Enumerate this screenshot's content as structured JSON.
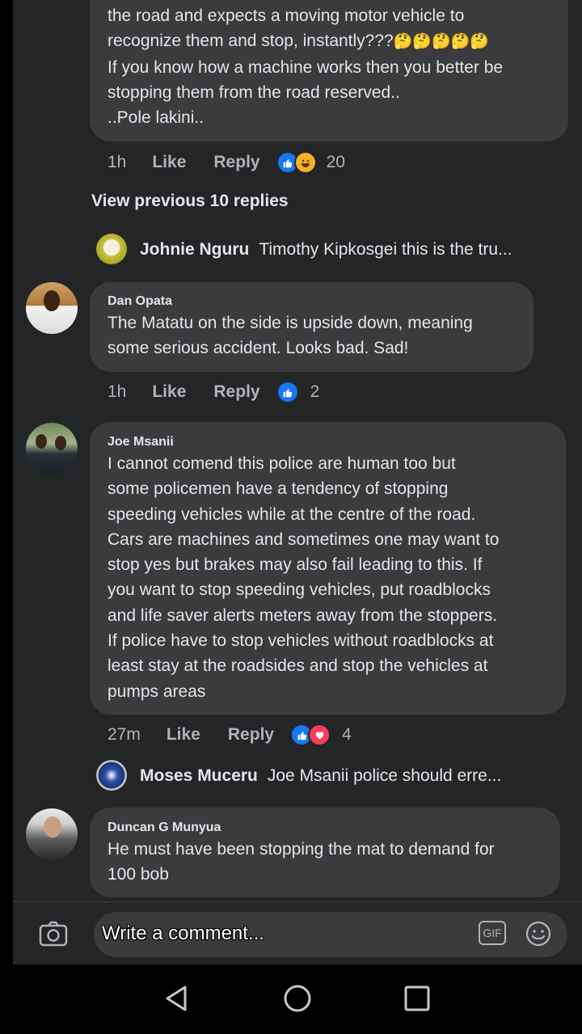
{
  "comments": [
    {
      "id": "top",
      "text": "the road and expects a moving motor vehicle to recognize them and stop, instantly???🤔🤔🤔🤔🤔 If you know how a machine works then you better be stopping them from the road reserved.. ..Pole lakini..",
      "lines": [
        "the road and expects a moving motor vehicle to",
        "recognize them and stop, instantly???",
        "If you know how a machine works then you better be",
        "stopping them from the road reserved..",
        "..Pole lakini.."
      ],
      "time": "1h",
      "like_label": "Like",
      "reply_label": "Reply",
      "reaction_count": "20"
    },
    {
      "id": "dan",
      "name": "Dan Opata",
      "lines": [
        "The Matatu on the side is upside down, meaning",
        "some serious accident. Looks bad. Sad!"
      ],
      "time": "1h",
      "like_label": "Like",
      "reply_label": "Reply",
      "reaction_count": "2"
    },
    {
      "id": "joe",
      "name": "Joe Msanii",
      "lines": [
        "I cannot comend this police are human too but",
        "some policemen have a tendency of stopping",
        "speeding vehicles while at the centre of the road.",
        "Cars are machines and sometimes one may want to",
        "stop yes but brakes may also fail leading to this. If",
        "you want to stop speeding vehicles, put roadblocks",
        "and life saver alerts meters away from the stoppers.",
        "If police have to stop vehicles without roadblocks at",
        "least stay at the roadsides and stop the vehicles at",
        "pumps areas"
      ],
      "time": "27m",
      "like_label": "Like",
      "reply_label": "Reply",
      "reaction_count": "4"
    },
    {
      "id": "duncan",
      "name": "Duncan G Munyua",
      "lines": [
        "He must have been stopping the mat to demand for",
        "100 bob"
      ]
    }
  ],
  "view_previous": "View previous 10 replies",
  "replies": [
    {
      "name": "Johnie Nguru",
      "text": "Timothy Kipkosgei this is the tru..."
    },
    {
      "name": "Moses Muceru",
      "text": "Joe Msanii  police should erre..."
    }
  ],
  "composer": {
    "placeholder": "Write a comment...",
    "gif_label": "GIF"
  },
  "colors": {
    "background": "#242526",
    "bubble": "#3a3b3c",
    "like_blue": "#1877f2",
    "love_red": "#f33e58",
    "haha_yellow": "#f7b125"
  }
}
